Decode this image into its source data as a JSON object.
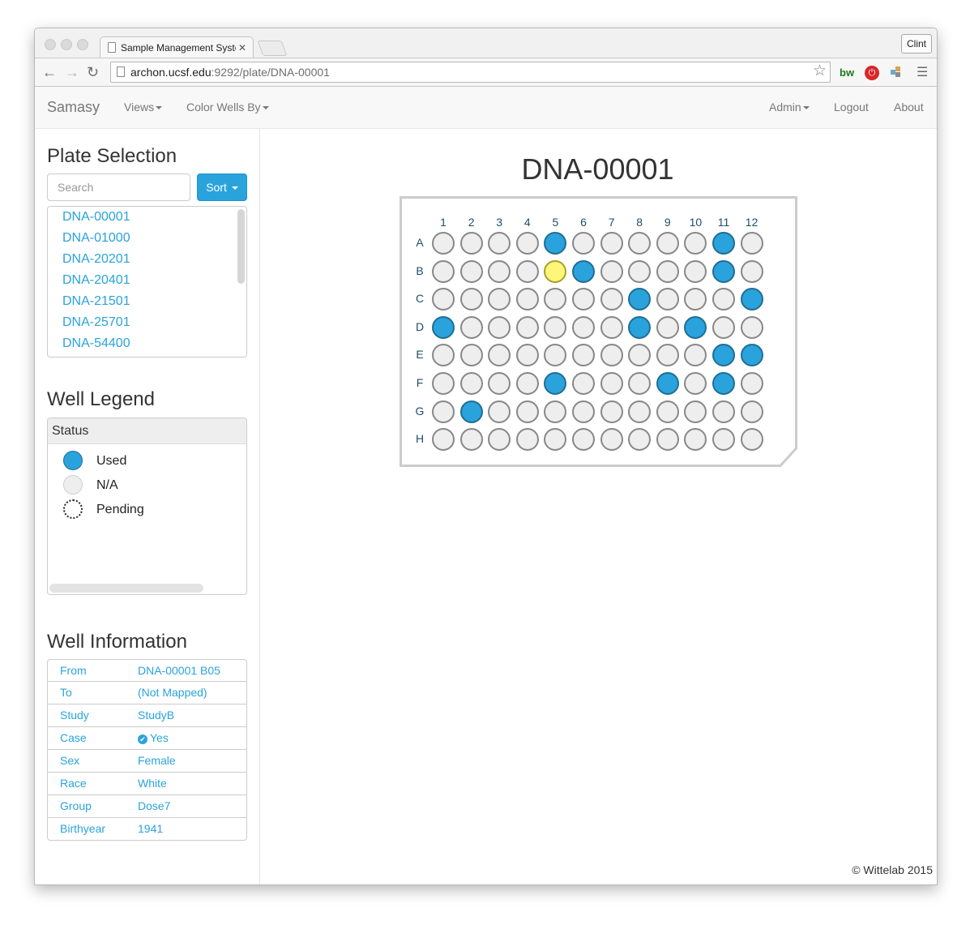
{
  "browser": {
    "tab_title": "Sample Management Syste",
    "profile_label": "Clint",
    "url_host": "archon.ucsf.edu",
    "url_rest": ":9292/plate/DNA-00001"
  },
  "navbar": {
    "brand": "Samasy",
    "views_label": "Views",
    "color_wells_label": "Color Wells By",
    "admin_label": "Admin",
    "logout_label": "Logout",
    "about_label": "About"
  },
  "sidebar": {
    "plate_selection_title": "Plate Selection",
    "search_placeholder": "Search",
    "sort_label": "Sort",
    "plates": [
      "DNA-00001",
      "DNA-01000",
      "DNA-20201",
      "DNA-20401",
      "DNA-21501",
      "DNA-25701",
      "DNA-54400"
    ],
    "well_legend_title": "Well Legend",
    "legend_header": "Status",
    "legend": [
      {
        "label": "Used",
        "color": "#2aa3dc"
      },
      {
        "label": "N/A",
        "color": "#eeeeee"
      },
      {
        "label": "Pending",
        "color": "#ffffff"
      }
    ],
    "well_info_title": "Well Information",
    "well_info": [
      {
        "key": "From",
        "value": "DNA-00001 B05"
      },
      {
        "key": "To",
        "value": "(Not Mapped)"
      },
      {
        "key": "Study",
        "value": "StudyB"
      },
      {
        "key": "Case",
        "value": "Yes"
      },
      {
        "key": "Sex",
        "value": "Female"
      },
      {
        "key": "Race",
        "value": "White"
      },
      {
        "key": "Group",
        "value": "Dose7"
      },
      {
        "key": "Birthyear",
        "value": "1941"
      }
    ]
  },
  "plate": {
    "title": "DNA-00001",
    "columns": [
      "1",
      "2",
      "3",
      "4",
      "5",
      "6",
      "7",
      "8",
      "9",
      "10",
      "11",
      "12"
    ],
    "rows": [
      "A",
      "B",
      "C",
      "D",
      "E",
      "F",
      "G",
      "H"
    ],
    "used_wells": [
      "A5",
      "A11",
      "B6",
      "B11",
      "C8",
      "C12",
      "D1",
      "D8",
      "D10",
      "E11",
      "E12",
      "F5",
      "F9",
      "F11",
      "G2"
    ],
    "selected_well": "B5",
    "colors": {
      "used": "#2aa3dc",
      "na": "#eeeeee",
      "selected": "#fff57a"
    }
  },
  "footer": "© Wittelab 2015"
}
